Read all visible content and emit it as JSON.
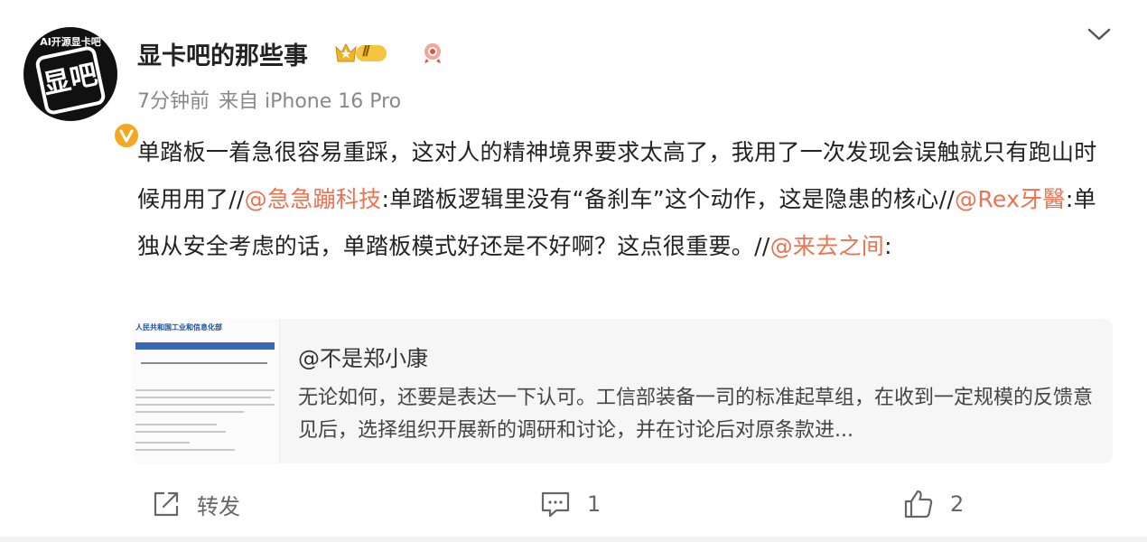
{
  "author": {
    "name": "显卡吧的那些事",
    "avatar_ring_text": "AI开源显卡吧",
    "avatar_glyph": "显吧",
    "verified_icon": "v-verified-icon",
    "level_badge": "Ⅱ",
    "colors": {
      "verified": "#f5a623",
      "mention": "#eb7350"
    }
  },
  "meta": {
    "time": "7分钟前",
    "source": "来自 iPhone 16 Pro"
  },
  "post": {
    "seg1": "单踏板一着急很容易重踩，这对人的精神境界要求太高了，我用了一次发现会误触就只有跑山时候用用了//",
    "mention1": "@急急蹦科技",
    "seg2": ":单踏板逻辑里没有“备刹车”这个动作，这是隐患的核心//",
    "mention2": "@Rex牙醫",
    "seg3": ":单独从安全考虑的话，单踏板模式好还是不好啊？这点很重要。//",
    "mention3": "@来去之间",
    "seg4": ":"
  },
  "quote": {
    "thumb_header": "人民共和国工业和信息化部",
    "author": "@不是郑小康",
    "text": "无论如何，还要是表达一下认可。工信部装备一司的标准起草组，在收到一定规模的反馈意见后，选择组织开展新的调研和讨论，并在讨论后对原条款进..."
  },
  "actions": {
    "repost_label": "转发",
    "comment_count": "1",
    "like_count": "2"
  }
}
